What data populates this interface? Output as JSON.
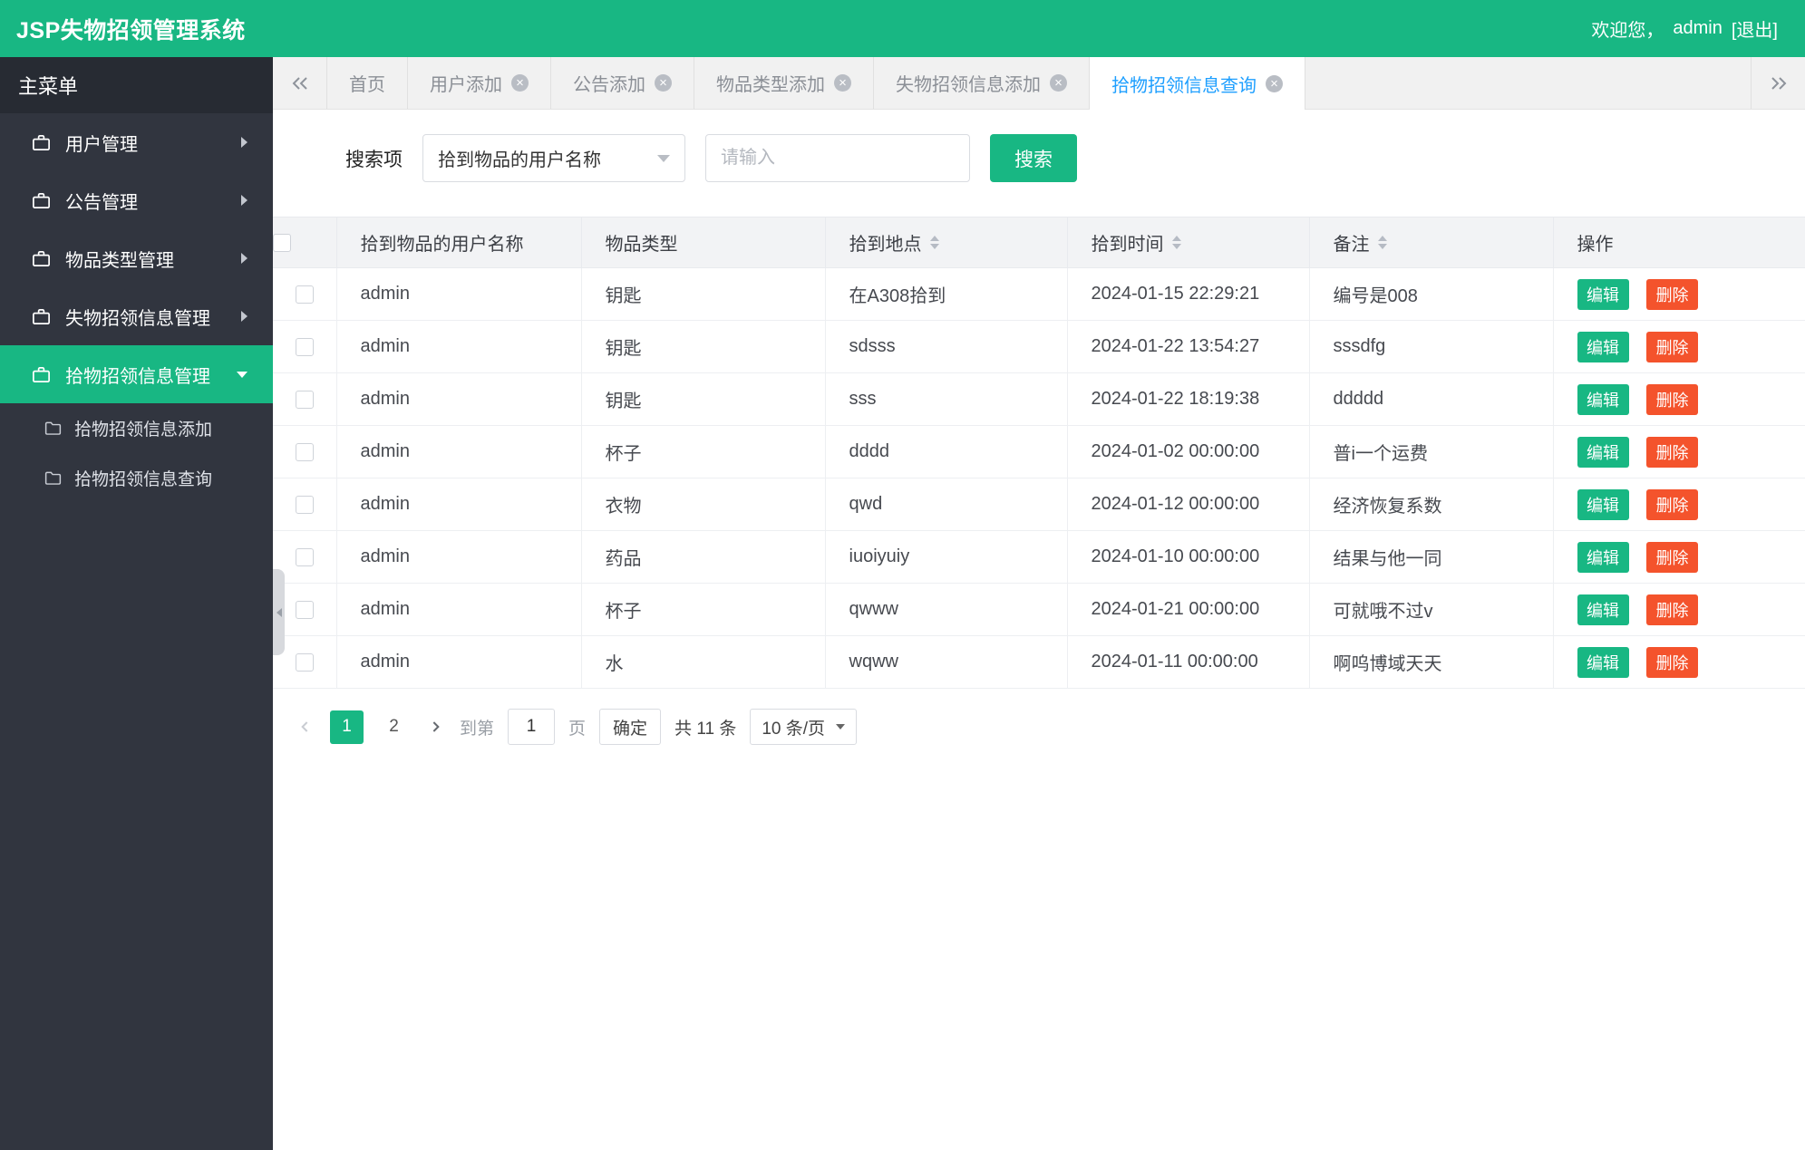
{
  "colors": {
    "accent": "#18b783",
    "danger": "#f4532c",
    "blue": "#1e9fff"
  },
  "header": {
    "title": "JSP失物招领管理系统",
    "welcome_prefix": "欢迎您，",
    "username": "admin",
    "logout": "[退出]"
  },
  "sidebar": {
    "menu_title": "主菜单",
    "items": [
      {
        "label": "用户管理",
        "expanded": false,
        "active": false
      },
      {
        "label": "公告管理",
        "expanded": false,
        "active": false
      },
      {
        "label": "物品类型管理",
        "expanded": false,
        "active": false
      },
      {
        "label": "失物招领信息管理",
        "expanded": false,
        "active": false
      },
      {
        "label": "拾物招领信息管理",
        "expanded": true,
        "active": true
      }
    ],
    "submenu": [
      {
        "label": "拾物招领信息添加"
      },
      {
        "label": "拾物招领信息查询"
      }
    ]
  },
  "tabs": [
    {
      "label": "首页",
      "closable": false,
      "active": false
    },
    {
      "label": "用户添加",
      "closable": true,
      "active": false
    },
    {
      "label": "公告添加",
      "closable": true,
      "active": false
    },
    {
      "label": "物品类型添加",
      "closable": true,
      "active": false
    },
    {
      "label": "失物招领信息添加",
      "closable": true,
      "active": false
    },
    {
      "label": "拾物招领信息查询",
      "closable": true,
      "active": true
    }
  ],
  "search": {
    "label": "搜索项",
    "field_selected": "拾到物品的用户名称",
    "input_placeholder": "请输入",
    "button_label": "搜索"
  },
  "table": {
    "columns": [
      "拾到物品的用户名称",
      "物品类型",
      "拾到地点",
      "拾到时间",
      "备注",
      "操作"
    ],
    "edit_label": "编辑",
    "delete_label": "删除",
    "rows": [
      {
        "user": "admin",
        "item_type": "钥匙",
        "place": "在A308拾到",
        "time": "2024-01-15 22:29:21",
        "note": "编号是008"
      },
      {
        "user": "admin",
        "item_type": "钥匙",
        "place": "sdsss",
        "time": "2024-01-22 13:54:27",
        "note": "sssdfg"
      },
      {
        "user": "admin",
        "item_type": "钥匙",
        "place": "sss",
        "time": "2024-01-22 18:19:38",
        "note": "ddddd"
      },
      {
        "user": "admin",
        "item_type": "杯子",
        "place": "dddd",
        "time": "2024-01-02 00:00:00",
        "note": "普i一个运费"
      },
      {
        "user": "admin",
        "item_type": "衣物",
        "place": "qwd",
        "time": "2024-01-12 00:00:00",
        "note": "经济恢复系数"
      },
      {
        "user": "admin",
        "item_type": "药品",
        "place": "iuoiyuiy",
        "time": "2024-01-10 00:00:00",
        "note": "结果与他一同"
      },
      {
        "user": "admin",
        "item_type": "杯子",
        "place": "qwww",
        "time": "2024-01-21 00:00:00",
        "note": "可就哦不过v"
      },
      {
        "user": "admin",
        "item_type": "水",
        "place": "wqww",
        "time": "2024-01-11 00:00:00",
        "note": "啊呜博域天天"
      }
    ]
  },
  "pagination": {
    "pages": [
      "1",
      "2"
    ],
    "current_page": "1",
    "goto_label": "到第",
    "goto_value": "1",
    "page_unit": "页",
    "confirm_label": "确定",
    "total_label": "共 11 条",
    "page_size_label": "10 条/页"
  }
}
